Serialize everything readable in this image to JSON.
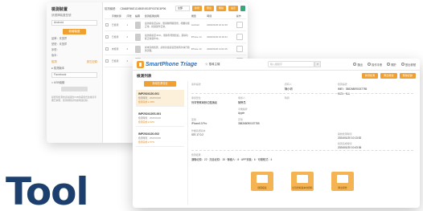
{
  "back_window": {
    "sidebar": {
      "title": "檢測裝置",
      "sub": "請選擇裝置型號",
      "select_value": "Android",
      "button": "新增裝置",
      "lines": [
        "品牌：未選擇",
        "型號：未選擇",
        "序號：",
        "版本："
      ],
      "link_left": "檢測",
      "link_right": "其它記錄",
      "radio_label": "● 檢測版本",
      "select2_value": "Facebook",
      "checkbox_label": "□ USB偵錯",
      "note": "提醒您檢測前請先開啟USB偵錯模式並確認手機已解鎖，檢測期間請勿拔除連接線。"
    },
    "top": {
      "label": "檢測編號：",
      "value": "C8468F86E1C4B0E491EF0375C6F96",
      "dropdown": "全部",
      "buttons": [
        "新增",
        "匯出",
        "刪除",
        "設定"
      ]
    },
    "columns": [
      "",
      "手機狀態",
      "序號",
      "縮圖",
      "檢測結果說明",
      "機型",
      "時間",
      "操作"
    ],
    "rows": [
      {
        "status": "已檢測",
        "idx": "1",
        "desc": "電池健康度良好，螢幕無明顯刮傷，相機功能正常，按鍵運作正常。",
        "model": "Android",
        "time": "2024/01/20 10:12:33"
      },
      {
        "status": "已檢測",
        "idx": "2",
        "desc": "電池健康度 82%，螢幕有輕微刮痕，其餘功能正常運作中。",
        "model": "iPhone 14",
        "time": "2024/01/20 10:20:41"
      },
      {
        "status": "未檢測",
        "idx": "3",
        "desc": "尚未完成檢測，請重新連接裝置後再次執行檢測流程。",
        "model": "iPhone 13",
        "time": "2024/01/20 11:02:15"
      },
      {
        "status": "已檢測",
        "idx": "4",
        "desc": "檢測完成，所有項目皆通過。",
        "model": "",
        "time": "2024/01/20 11:31:09"
      }
    ]
  },
  "big_label": "Tool",
  "front_window": {
    "app_title": "SmartPhone Triage",
    "search_label": "☆ 搜尋主機",
    "search_placeholder": "輸入關鍵字",
    "search_icon": "magnifier-icon",
    "header_items": [
      "匯出",
      "操作手冊",
      "關於",
      "登出帳號"
    ],
    "page_title": "檢測列表",
    "action_buttons": [
      "新增檢測",
      "匯出報告",
      "刪除記錄"
    ],
    "add_button": "新增檢測項目",
    "cards": [
      {
        "id": "IMP2024120-001",
        "line1": "檢測時間：2024/01/20",
        "status": "檢測完成 ● 48%",
        "active": true
      },
      {
        "id": "IMP2024120S-001",
        "line1": "檢測時間：2024/01/20",
        "status": "檢測完成 ● 62%",
        "active": false
      },
      {
        "id": "IMP2024120-002",
        "line1": "檢測時間：2024/01/20",
        "status": "檢測完成 ● 57%",
        "active": false
      }
    ],
    "detail": {
      "case_label": "案件編號",
      "case_value": "",
      "owner_label": "持有人",
      "owner_value": "陳小明",
      "ref_label": "檢測編號",
      "ref_value": "IMEI：358268090157785",
      "ref_value2": "IMSI：N/A",
      "unit_label": "承辦單位",
      "unit_value": "刑事警察局數位鑑識組",
      "agent_label": "承辦人",
      "agent_value": "陳警員",
      "date_label": "時間",
      "date_value": "",
      "type_label": "手機廠牌",
      "type_value": "Apple",
      "model_label": "型號",
      "model_value": "iPhone13 Pro",
      "os_label": "作業系統版本",
      "os_value": "iOS 17.0.2",
      "serial_label": "序號",
      "serial_value": "358268090157785",
      "start_label": "開始檢測時間",
      "start_value": "2024/01/20 10:13:52",
      "end_label": "檢測完成時間",
      "end_value": "2024/01/20 10:43:36",
      "summary_label": "檢測結果",
      "summary_value": "通聯紀錄：22 · 訊息紀錄：15 · 聯絡人：8 · APP安裝：6 · 可疑程式：4"
    },
    "tiles": [
      "擷取檔案",
      "比對雲端與本地資料",
      "匯出報告"
    ]
  }
}
